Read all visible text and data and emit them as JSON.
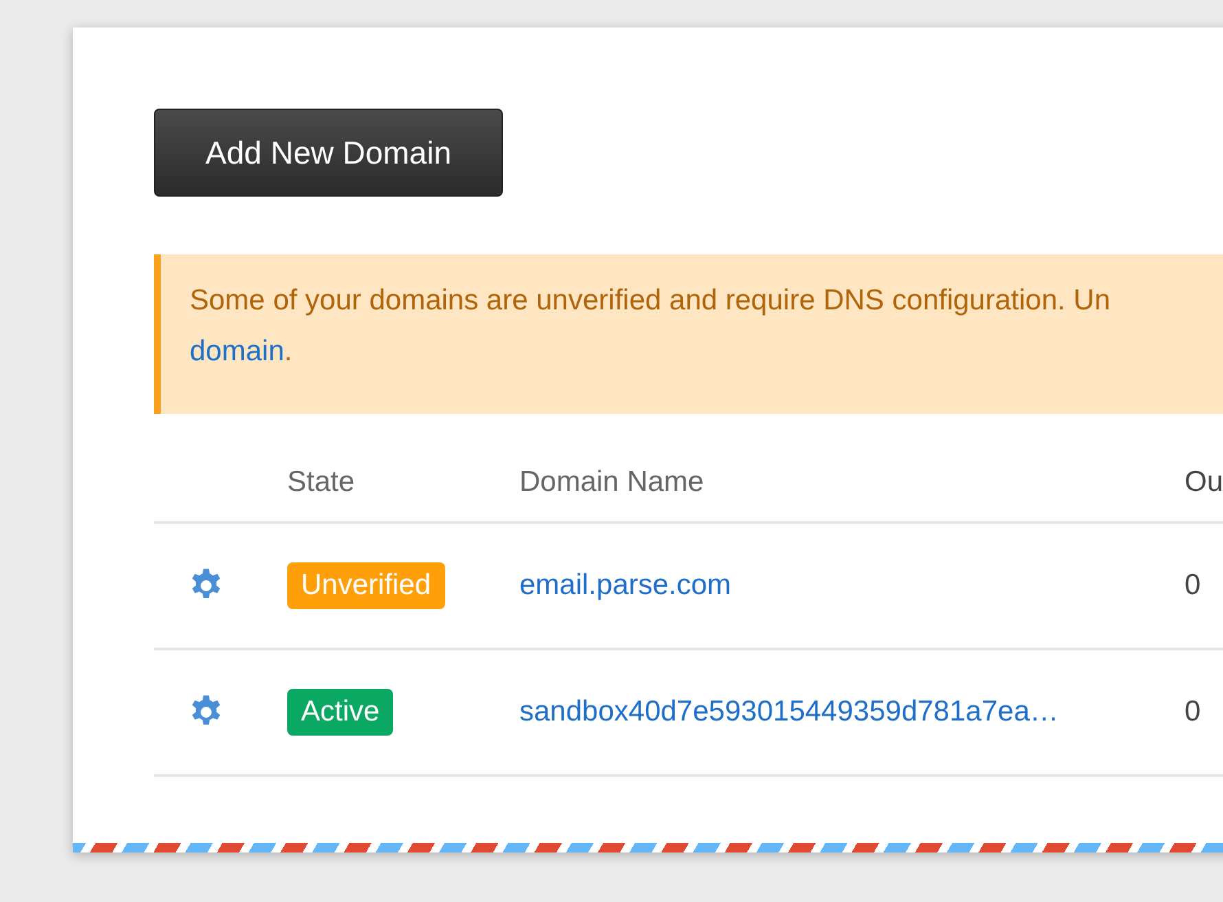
{
  "add_button": {
    "label": "Add New Domain"
  },
  "alert": {
    "text": "Some of your domains are unverified and require DNS configuration. Un",
    "link": "domain",
    "after_link": "."
  },
  "table": {
    "columns": [
      "State",
      "Domain Name",
      "Ou"
    ],
    "rows": [
      {
        "state": "Unverified",
        "kind": "unverified",
        "domain": "email.parse.com",
        "column_3": "0"
      },
      {
        "state": "Active",
        "kind": "active",
        "domain": "sandbox40d7e593015449359d781a7ea…",
        "column_3": "0"
      }
    ]
  }
}
